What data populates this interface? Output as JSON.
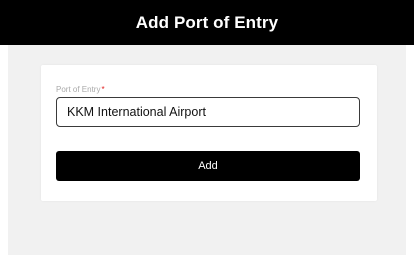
{
  "header": {
    "title": "Add Port of Entry"
  },
  "form": {
    "port_label": "Port of Entry",
    "required_mark": "*",
    "port_value": "KKM International Airport",
    "add_label": "Add"
  },
  "colors": {
    "header_bg": "#000000",
    "page_bg": "#f1f1f1",
    "required": "#e11b1b",
    "button_bg": "#000000"
  }
}
